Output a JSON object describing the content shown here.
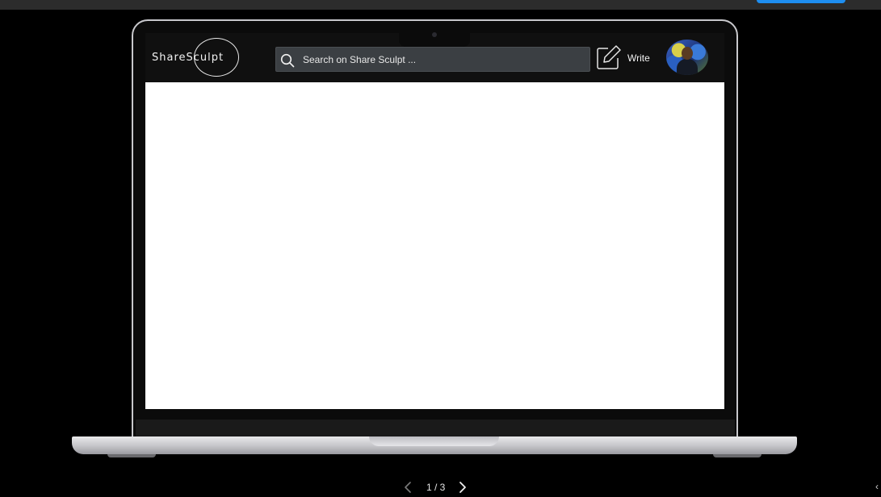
{
  "app": {
    "logo_text": "ShareSculpt",
    "search": {
      "placeholder": "Search on Share Sculpt ..."
    },
    "write_label": "Write",
    "avatar_alt": "User avatar"
  },
  "pager": {
    "text": "1 / 3"
  },
  "colors": {
    "header_bg": "#101010",
    "search_bg": "#3b3f43",
    "top_button": "#1e8ef0",
    "page_bg": "#000000"
  },
  "icons": {
    "search": "search-icon",
    "write": "edit-square-icon",
    "prev": "chevron-left-icon",
    "next": "chevron-right-icon"
  }
}
